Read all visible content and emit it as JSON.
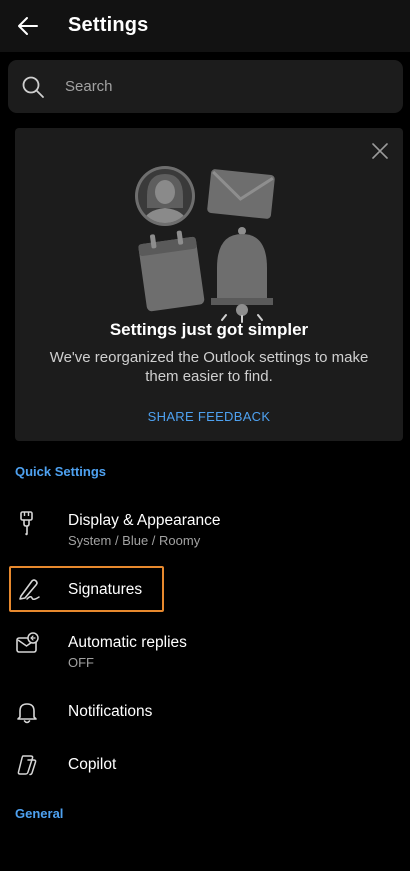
{
  "header": {
    "title": "Settings",
    "back_icon": "arrow-left-icon"
  },
  "search": {
    "placeholder": "Search",
    "icon": "search-icon"
  },
  "promo_card": {
    "title": "Settings just got simpler",
    "body": "We've reorganized the Outlook settings to make them easier to find.",
    "link": "SHARE FEEDBACK",
    "close_icon": "close-icon",
    "illustration_icons": [
      "person-icon",
      "envelope-icon",
      "calendar-icon",
      "bell-icon"
    ]
  },
  "sections": {
    "quick": "Quick Settings",
    "general": "General"
  },
  "quick_settings": [
    {
      "label": "Display & Appearance",
      "sub": "System / Blue / Roomy",
      "icon": "paint-brush-icon"
    },
    {
      "label": "Signatures",
      "sub": "",
      "icon": "signature-pen-icon",
      "highlighted": true
    },
    {
      "label": "Automatic replies",
      "sub": "OFF",
      "icon": "auto-reply-mail-icon"
    },
    {
      "label": "Notifications",
      "sub": "",
      "icon": "bell-icon"
    },
    {
      "label": "Copilot",
      "sub": "",
      "icon": "copilot-icon"
    }
  ],
  "colors": {
    "background": "#000000",
    "header": "#121212",
    "surface": "#1c1c1c",
    "accent": "#4ea1f0",
    "highlight": "#e7892e",
    "secondary_text": "#a2a2a2"
  }
}
